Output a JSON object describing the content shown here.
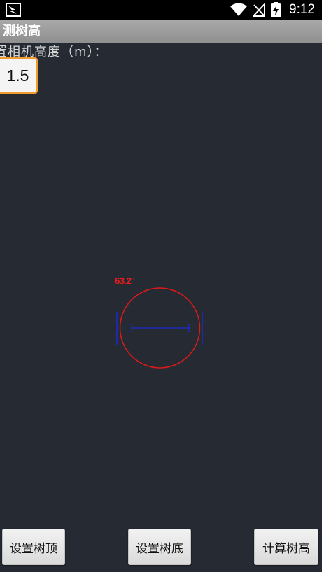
{
  "status_bar": {
    "time": "9:12",
    "icons": [
      "app-notification-icon",
      "wifi-icon",
      "no-signal-icon",
      "battery-charging-icon"
    ]
  },
  "title_bar": {
    "title": "测树高"
  },
  "camera_height": {
    "label": "置相机高度（m）：",
    "value": "1.5"
  },
  "overlay": {
    "angle_text": "63.2°",
    "colors": {
      "crosshair": "#e01919",
      "level_bar": "#1f2bd0"
    }
  },
  "buttons": {
    "set_top": "设置树顶",
    "set_bottom": "设置树底",
    "calculate": "计算树高"
  },
  "colors": {
    "background": "#252a33",
    "title_bar": "#9a9a9a",
    "input_border": "#f19a2d"
  }
}
